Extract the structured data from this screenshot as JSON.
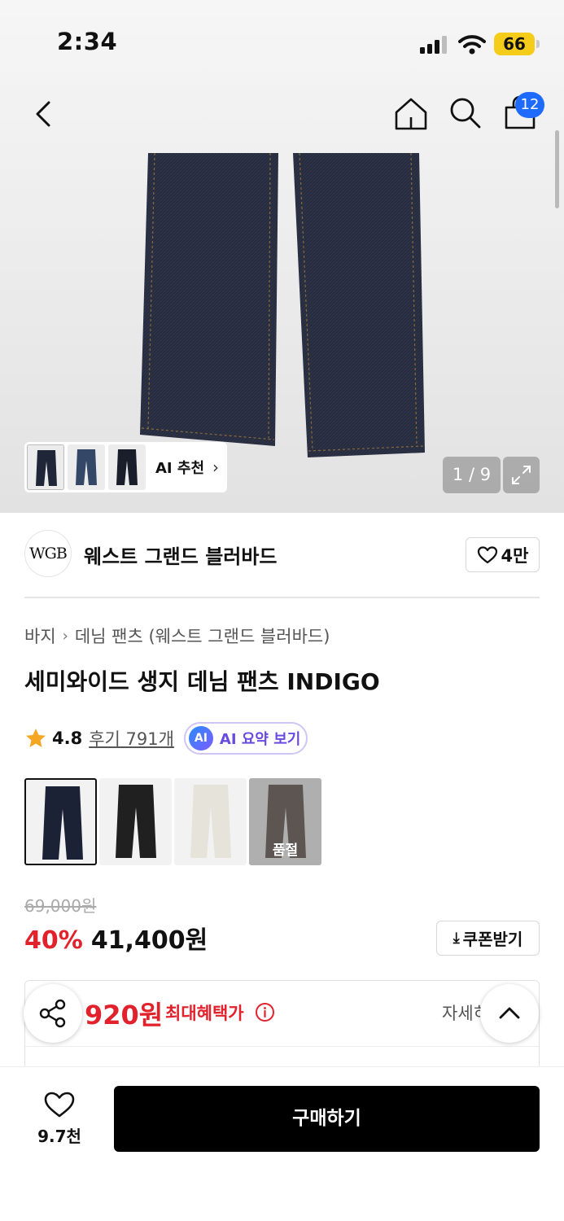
{
  "status_bar": {
    "time": "2:34",
    "battery": "66"
  },
  "header": {
    "cart_count": "12"
  },
  "gallery": {
    "ai_recommend_label": "AI 추천",
    "page_indicator": "1 / 9"
  },
  "brand": {
    "logo_text": "WGB",
    "name": "웨스트 그랜드 블러바드",
    "like_count": "4만"
  },
  "breadcrumb": [
    "바지",
    "데님 팬츠 (웨스트 그랜드 블러바드)"
  ],
  "product": {
    "title": "세미와이드 생지 데님 팬츠 INDIGO",
    "rating": "4.8",
    "review_link": "후기 791개",
    "ai_badge": "AI",
    "ai_summary_label": "AI 요약 보기"
  },
  "color_options": [
    {
      "color": "#1c2236",
      "selected": true,
      "sold_out": false
    },
    {
      "color": "#202020",
      "selected": false,
      "sold_out": false
    },
    {
      "color": "#e6e3da",
      "selected": false,
      "sold_out": false
    },
    {
      "color": "#3d2a22",
      "selected": false,
      "sold_out": true,
      "sold_out_label": "품절"
    }
  ],
  "price": {
    "original": "69,000원",
    "discount": "40%",
    "sale": "41,400원",
    "coupon_label": "쿠폰받기"
  },
  "benefit": {
    "amount": "920원",
    "label": "최대혜택가",
    "detail_label": "자세히"
  },
  "bottom_bar": {
    "wish_count": "9.7천",
    "buy_label": "구매하기"
  },
  "colors": {
    "accent_red": "#e1212b",
    "badge_blue": "#1f6bff",
    "ai_purple": "#6a4be0"
  }
}
